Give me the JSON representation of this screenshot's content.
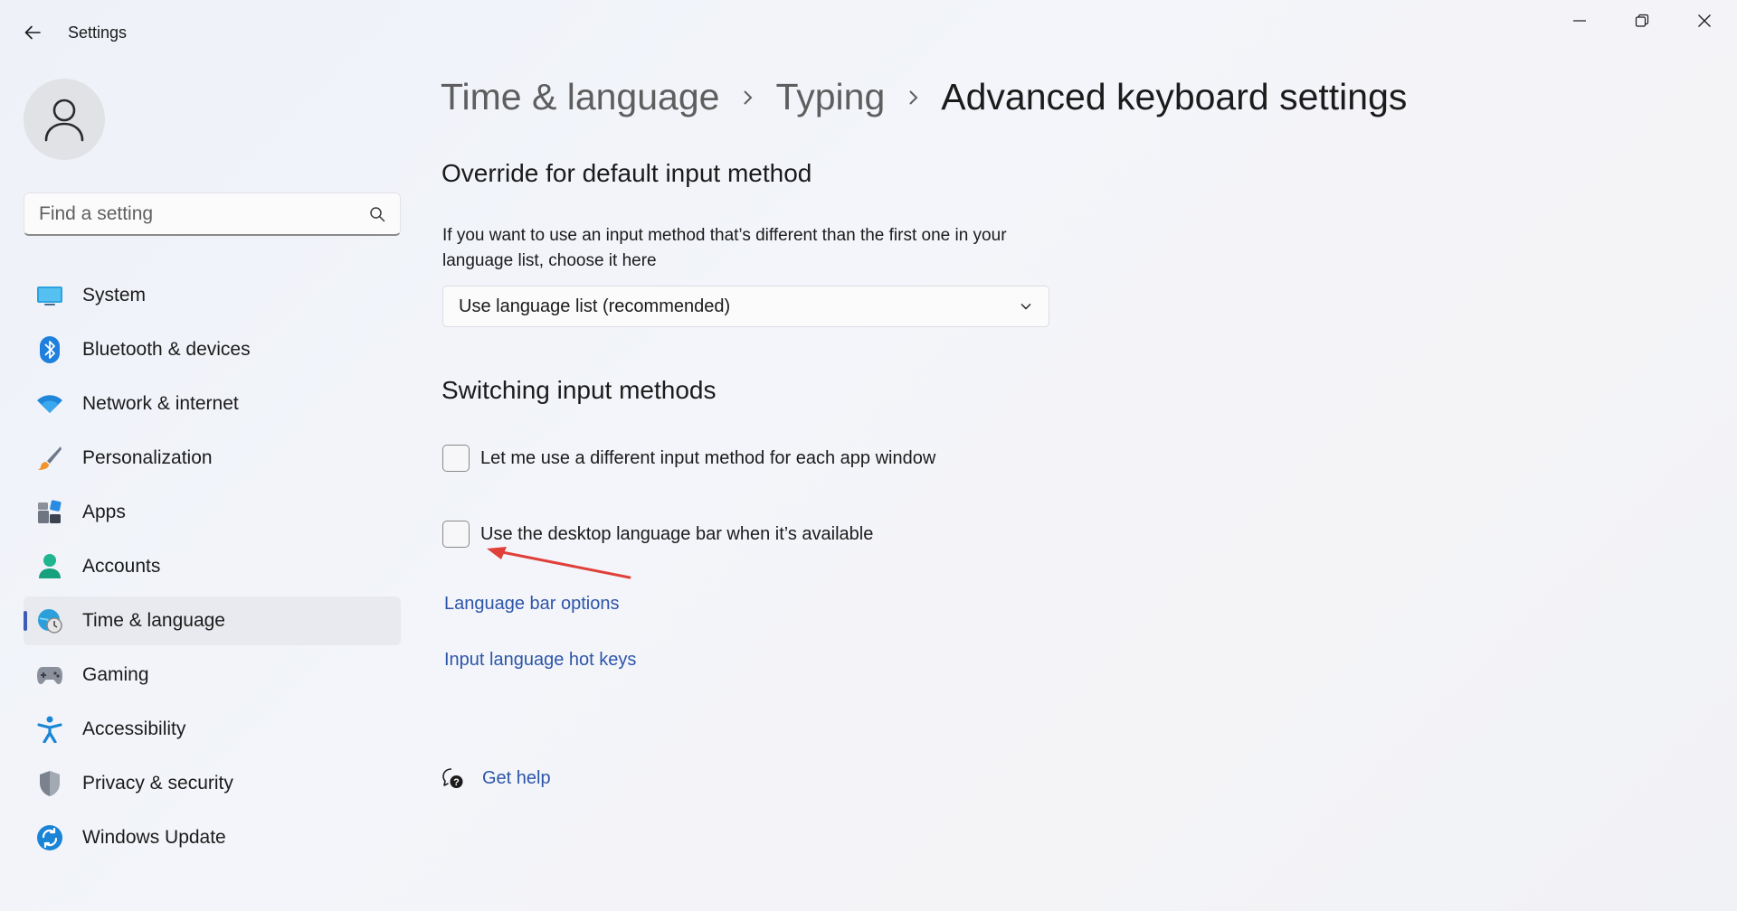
{
  "window": {
    "title": "Settings"
  },
  "search": {
    "placeholder": "Find a setting"
  },
  "sidebar": {
    "items": [
      {
        "label": "System",
        "icon": "monitor-icon",
        "active": false
      },
      {
        "label": "Bluetooth & devices",
        "icon": "bluetooth-icon",
        "active": false
      },
      {
        "label": "Network & internet",
        "icon": "wifi-icon",
        "active": false
      },
      {
        "label": "Personalization",
        "icon": "brush-icon",
        "active": false
      },
      {
        "label": "Apps",
        "icon": "apps-icon",
        "active": false
      },
      {
        "label": "Accounts",
        "icon": "person-icon",
        "active": false
      },
      {
        "label": "Time & language",
        "icon": "globe-clock-icon",
        "active": true
      },
      {
        "label": "Gaming",
        "icon": "gamepad-icon",
        "active": false
      },
      {
        "label": "Accessibility",
        "icon": "accessibility-icon",
        "active": false
      },
      {
        "label": "Privacy & security",
        "icon": "shield-icon",
        "active": false
      },
      {
        "label": "Windows Update",
        "icon": "update-icon",
        "active": false
      }
    ]
  },
  "breadcrumb": {
    "items": [
      "Time & language",
      "Typing"
    ],
    "current": "Advanced keyboard settings"
  },
  "override": {
    "title": "Override for default input method",
    "description": "If you want to use an input method that’s different than the first one in your language list, choose it here",
    "dropdown_value": "Use language list (recommended)"
  },
  "switching": {
    "title": "Switching input methods",
    "options": [
      {
        "label": "Let me use a different input method for each app window",
        "checked": false
      },
      {
        "label": "Use the desktop language bar when it’s available",
        "checked": false
      }
    ],
    "links": [
      "Language bar options",
      "Input language hot keys"
    ]
  },
  "help": {
    "label": "Get help"
  },
  "colors": {
    "accent": "#3d5cb8",
    "link": "#2c55a8",
    "annotation": "#e0403a"
  }
}
